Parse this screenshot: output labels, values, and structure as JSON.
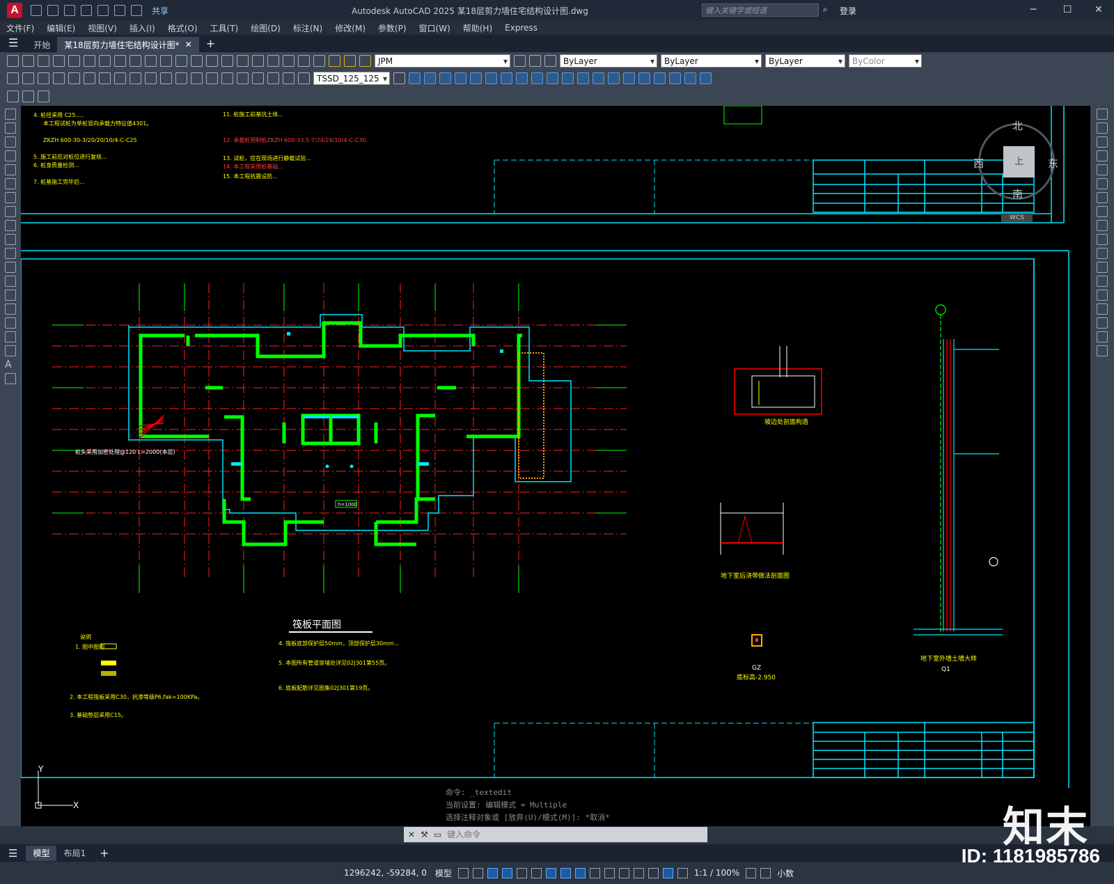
{
  "titlebar": {
    "share": "共享",
    "window_title": "Autodesk AutoCAD 2025    某18层剪力墙住宅结构设计图.dwg",
    "search_placeholder": "键入关键字或短语",
    "login": "登录"
  },
  "menus": [
    "文件(F)",
    "编辑(E)",
    "视图(V)",
    "插入(I)",
    "格式(O)",
    "工具(T)",
    "绘图(D)",
    "标注(N)",
    "修改(M)",
    "参数(P)",
    "窗口(W)",
    "帮助(H)",
    "Express"
  ],
  "tabs": {
    "start": "开始",
    "doc": "某18层剪力墙住宅结构设计图*"
  },
  "toolbar": {
    "layer": "JPM",
    "color": "ByLayer",
    "linetype": "ByLayer",
    "lineweight": "ByLayer",
    "plotstyle": "ByColor",
    "dimstyle": "TSSD_125_125"
  },
  "viewcube": {
    "north": "北",
    "south": "南",
    "east": "东",
    "west": "西",
    "top": "上",
    "wcs": "WCS"
  },
  "drawing": {
    "plan_title": "筏板平面图",
    "note_top": [
      "11. 桩施工前基坑土体...",
      "12. 承载桩预制桩ZKZH 600-33.5-7/24/24/10/4-C-C30,",
      "13. 试桩，应在现场进行静载试验...",
      "14. 本工程采用桩基础...",
      "15. 本工程抗震设防..."
    ],
    "note_top_left": [
      "4. 桩径采用 C25.....",
      "本工程试桩为单桩竖向承载力特征值4301。",
      "ZKZH 600-30-3/20/20/10/4-C-C25",
      "5. 施工前应对桩位进行复核...",
      "6. 桩身质量检测...",
      "7. 桩基施工完毕后..."
    ],
    "legend_title": "说明",
    "legend": [
      "1. 图中图例",
      "2. 本工程筏板采用C30，抗渗等级P6,fak=100KPa。",
      "3. 基础垫层采用C15。"
    ],
    "mid_notes": [
      "4. 筏板底部保护层50mm，顶部保护层30mm...",
      "5. 本图所有管道穿墙处详见02J301第55页。",
      "6. 底板配筋详见图集02J301第19页。"
    ],
    "detail1": "坡边处剖面构造",
    "detail2": "地下室后浇带做法剖面图",
    "detail3": "地下室外墙土墙大样",
    "detail3_sub": "Q1",
    "gz": "GZ",
    "gz_note": "底标高-2.950",
    "ramp_label": "桩头采用加密处理@120 L=2000(本层)",
    "h_label": "h=1000"
  },
  "cmd": {
    "history": [
      "命令: _textedit",
      "当前设置: 编辑模式 = Multiple",
      "选择注释对象或 [放弃(U)/模式(M)]: *取消*"
    ],
    "placeholder": "键入命令"
  },
  "layouts": {
    "model": "模型",
    "layout1": "布局1"
  },
  "status": {
    "coords": "1296242, -59284, 0",
    "model": "模型",
    "scale": "1:1 / 100%",
    "units": "小数"
  },
  "watermark": {
    "brand": "知末",
    "id": "ID: 1181985786"
  }
}
